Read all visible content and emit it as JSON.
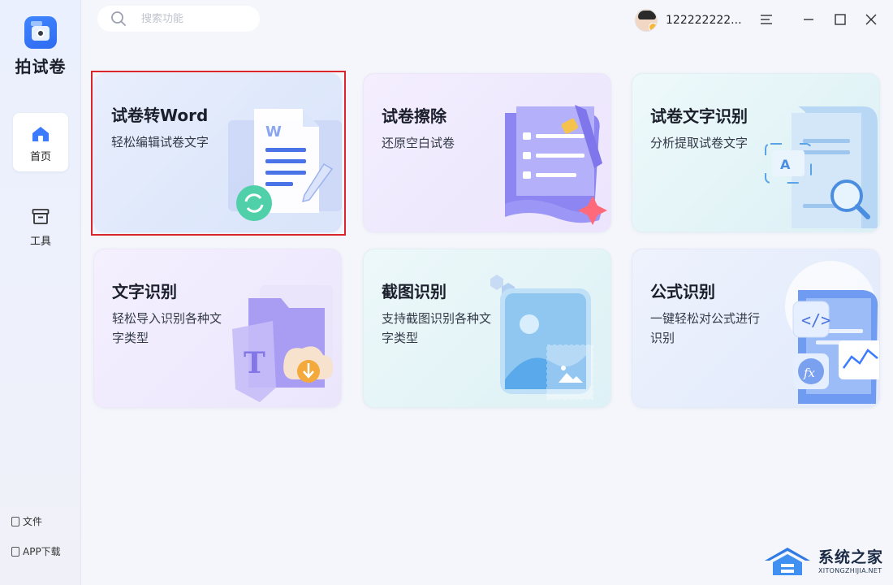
{
  "app": {
    "name": "拍试卷"
  },
  "sidebar": {
    "nav": [
      {
        "label": "首页",
        "icon": "home-icon",
        "active": true
      },
      {
        "label": "工具",
        "icon": "toolbox-icon",
        "active": false
      }
    ],
    "links": [
      {
        "label": "文件",
        "icon": "file-icon"
      },
      {
        "label": "APP下载",
        "icon": "phone-icon"
      }
    ]
  },
  "search": {
    "placeholder": "搜索功能",
    "value": ""
  },
  "user": {
    "name": "122222222..."
  },
  "window_controls": [
    "menu-icon",
    "minimize-icon",
    "maximize-icon",
    "close-icon"
  ],
  "cards": [
    {
      "title": "试卷转Word",
      "desc": "轻松编辑试卷文字",
      "selected": true
    },
    {
      "title": "试卷擦除",
      "desc": "还原空白试卷"
    },
    {
      "title": "试卷文字识别",
      "desc": "分析提取试卷文字"
    },
    {
      "title": "文字识别",
      "desc": "轻松导入识别各种文字类型"
    },
    {
      "title": "截图识别",
      "desc": "支持截图识别各种文字类型"
    },
    {
      "title": "公式识别",
      "desc": "一键轻松对公式进行识别"
    }
  ],
  "watermark": {
    "text": "系统之家",
    "sub": "XITONGZHIJIA.NET"
  },
  "colors": {
    "accent": "#3a7bff",
    "highlight_border": "#d8262c",
    "sidebar_bg": "#eaf0fd"
  }
}
